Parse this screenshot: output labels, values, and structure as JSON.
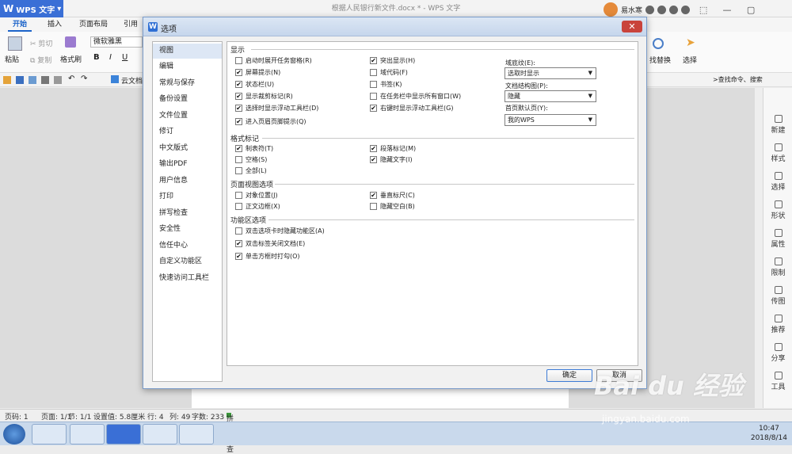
{
  "app": {
    "name": "WPS 文字",
    "doc_title": "根据人民银行新文件.docx * - WPS 文字",
    "user": "易水寒"
  },
  "tabs": [
    "开始",
    "插入",
    "页面布局",
    "引用"
  ],
  "ribbon": {
    "paste": "粘贴",
    "cut": "剪切",
    "copy": "复制",
    "format_painter": "格式刷",
    "font": "微软雅黑",
    "find_replace": "找替换",
    "select": "选择",
    "cloud": "云文档",
    "search_cmd": "查找命令、搜索"
  },
  "right_panel": [
    "新建",
    "样式",
    "选择",
    "形状",
    "属性",
    "限制",
    "传图",
    "推荐",
    "分享",
    "工具"
  ],
  "status": {
    "page": "页码: 1",
    "pages": "页面: 1/1",
    "section": "节: 1/1",
    "setting": "设置值: 5.8厘米",
    "row": "行: 4",
    "col": "列: 49",
    "words": "字数: 233",
    "spell": "拼写检查"
  },
  "clock": {
    "time": "10:47",
    "date": "2018/8/14"
  },
  "watermark": {
    "brand": "Bai du 经验",
    "url": "jingyan.baidu.com"
  },
  "dialog": {
    "title": "选项",
    "nav": [
      "视图",
      "编辑",
      "常规与保存",
      "备份设置",
      "文件位置",
      "修订",
      "中文版式",
      "输出PDF",
      "用户信息",
      "打印",
      "拼写检查",
      "安全性",
      "信任中心",
      "自定义功能区",
      "快速访问工具栏"
    ],
    "sections": {
      "display": "显示",
      "format_marks": "格式标记",
      "page_view": "页面视图选项",
      "ribbon_opts": "功能区选项"
    },
    "display_left": [
      {
        "label": "启动时展开任务窗格(R)",
        "checked": false
      },
      {
        "label": "屏幕提示(N)",
        "checked": true
      },
      {
        "label": "状态栏(U)",
        "checked": true
      },
      {
        "label": "显示裁剪标记(R)",
        "checked": true
      },
      {
        "label": "选择时显示浮动工具栏(D)",
        "checked": true
      },
      {
        "label": "进入页眉页脚提示(Q)",
        "checked": true
      }
    ],
    "display_mid": [
      {
        "label": "突出显示(H)",
        "checked": true
      },
      {
        "label": "域代码(F)",
        "checked": false
      },
      {
        "label": "书签(K)",
        "checked": false
      },
      {
        "label": "在任务栏中显示所有窗口(W)",
        "checked": false
      },
      {
        "label": "右键时显示浮动工具栏(G)",
        "checked": true
      }
    ],
    "field_shading": {
      "label": "域底纹(E):",
      "value": "选取时显示"
    },
    "doc_map": {
      "label": "文档结构图(P):",
      "value": "隐藏"
    },
    "home_page": {
      "label": "首页默认页(Y):",
      "value": "我的WPS"
    },
    "marks_left": [
      {
        "label": "制表符(T)",
        "checked": true
      },
      {
        "label": "空格(S)",
        "checked": false
      },
      {
        "label": "全部(L)",
        "checked": false
      }
    ],
    "marks_mid": [
      {
        "label": "段落标记(M)",
        "checked": true
      },
      {
        "label": "隐藏文字(I)",
        "checked": true
      }
    ],
    "page_left": [
      {
        "label": "对象位置(J)",
        "checked": false
      },
      {
        "label": "正文边框(X)",
        "checked": false
      }
    ],
    "page_mid": [
      {
        "label": "垂直标尺(C)",
        "checked": true
      },
      {
        "label": "隐藏空白(B)",
        "checked": false
      }
    ],
    "ribbon_list": [
      {
        "label": "双击选项卡时隐藏功能区(A)",
        "checked": false
      },
      {
        "label": "双击标签关闭文档(E)",
        "checked": true
      },
      {
        "label": "单击方框时打勾(O)",
        "checked": true
      }
    ],
    "ok": "确定",
    "cancel": "取消"
  }
}
